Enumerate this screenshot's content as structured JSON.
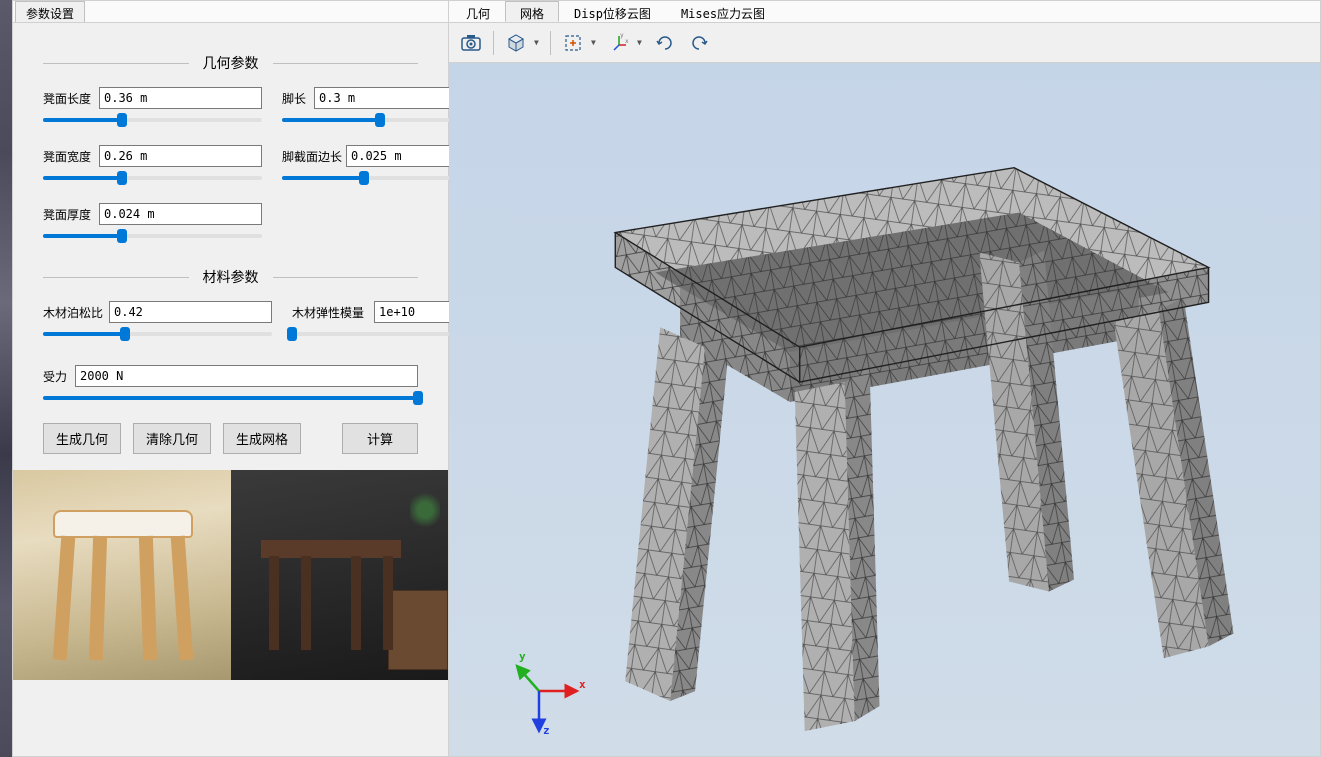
{
  "sidePanel": {
    "tabLabel": "参数设置",
    "geometrySection": "几何参数",
    "materialSection": "材料参数",
    "params": {
      "seatLength": {
        "label": "凳面长度",
        "value": "0.36 m",
        "pct": 36
      },
      "legLength": {
        "label": "脚长",
        "value": "0.3 m",
        "pct": 50
      },
      "seatWidth": {
        "label": "凳面宽度",
        "value": "0.26 m",
        "pct": 36
      },
      "legSection": {
        "label": "脚截面边长",
        "value": "0.025 m",
        "pct": 36
      },
      "seatThick": {
        "label": "凳面厚度",
        "value": "0.024 m",
        "pct": 36
      },
      "poisson": {
        "label": "木材泊松比",
        "value": "0.42",
        "pct": 36
      },
      "elastic": {
        "label": "木材弹性模量",
        "value": "1e+10",
        "pct": 0
      },
      "force": {
        "label": "受力",
        "value": "2000 N",
        "pct": 100
      }
    },
    "buttons": {
      "genGeom": "生成几何",
      "clearGeom": "清除几何",
      "genMesh": "生成网格",
      "compute": "计算"
    }
  },
  "mainTabs": {
    "geometry": "几何",
    "mesh": "网格",
    "disp": "Disp位移云图",
    "mises": "Mises应力云图"
  },
  "axes": {
    "x": "x",
    "y": "y",
    "z": "z"
  }
}
